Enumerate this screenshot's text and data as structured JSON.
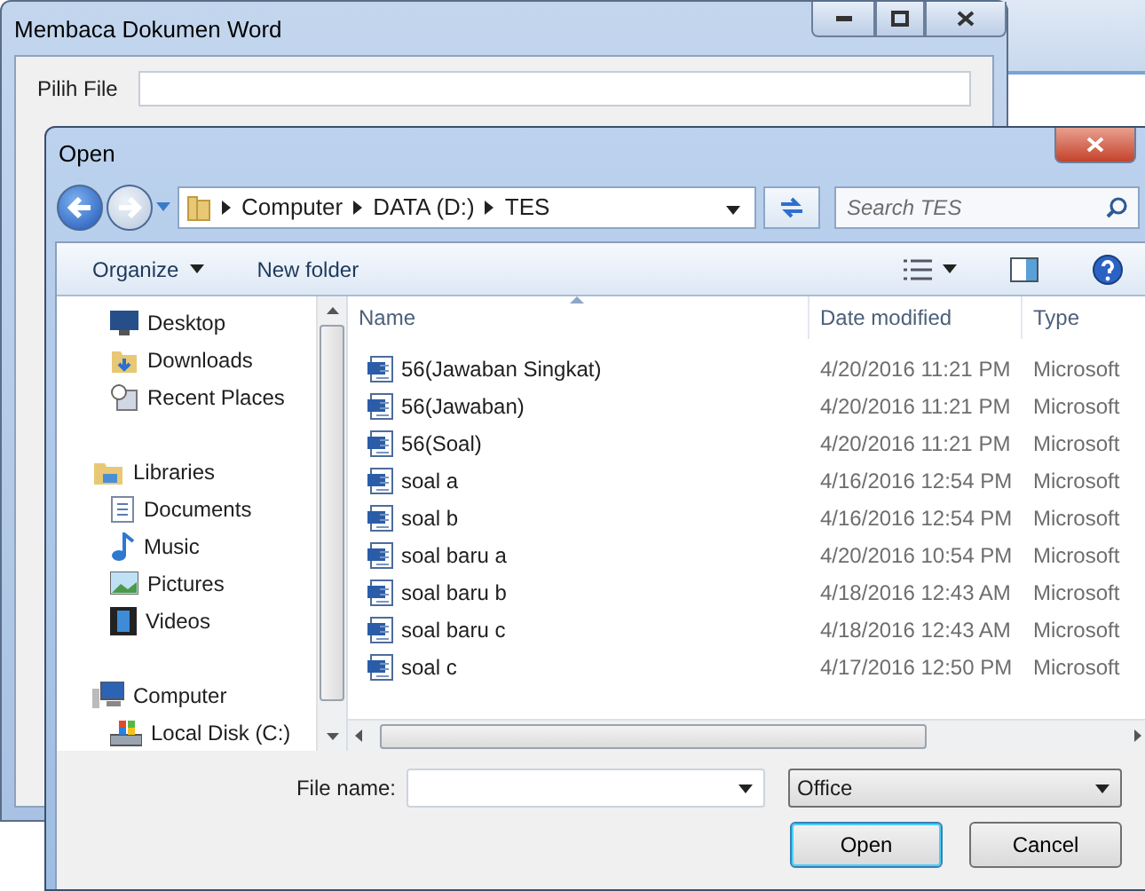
{
  "main_window": {
    "title": "Membaca Dokumen Word",
    "field_label": "Pilih File"
  },
  "dialog": {
    "title": "Open",
    "breadcrumb": [
      "Computer",
      "DATA (D:)",
      "TES"
    ],
    "search_placeholder": "Search TES",
    "toolbar": [
      "Organize",
      "New folder"
    ],
    "nav": [
      {
        "label": "Desktop",
        "kind": "item"
      },
      {
        "label": "Downloads",
        "kind": "item"
      },
      {
        "label": "Recent Places",
        "kind": "item"
      },
      {
        "label": "Libraries",
        "kind": "group"
      },
      {
        "label": "Documents",
        "kind": "item"
      },
      {
        "label": "Music",
        "kind": "item"
      },
      {
        "label": "Pictures",
        "kind": "item"
      },
      {
        "label": "Videos",
        "kind": "item"
      },
      {
        "label": "Computer",
        "kind": "group"
      },
      {
        "label": "Local Disk (C:)",
        "kind": "item"
      }
    ],
    "columns": [
      {
        "label": "Name",
        "sorted": true
      },
      {
        "label": "Date modified",
        "sorted": false
      },
      {
        "label": "Type",
        "sorted": false
      }
    ],
    "files": [
      {
        "name": "56(Jawaban Singkat)",
        "date": "4/20/2016 11:21 PM",
        "type": "Microsoft"
      },
      {
        "name": "56(Jawaban)",
        "date": "4/20/2016 11:21 PM",
        "type": "Microsoft"
      },
      {
        "name": "56(Soal)",
        "date": "4/20/2016 11:21 PM",
        "type": "Microsoft"
      },
      {
        "name": "soal a",
        "date": "4/16/2016 12:54 PM",
        "type": "Microsoft"
      },
      {
        "name": "soal b",
        "date": "4/16/2016 12:54 PM",
        "type": "Microsoft"
      },
      {
        "name": "soal baru a",
        "date": "4/20/2016 10:54 PM",
        "type": "Microsoft"
      },
      {
        "name": "soal baru b",
        "date": "4/18/2016 12:43 AM",
        "type": "Microsoft"
      },
      {
        "name": "soal baru c",
        "date": "4/18/2016 12:43 AM",
        "type": "Microsoft"
      },
      {
        "name": "soal c",
        "date": "4/17/2016 12:50 PM",
        "type": "Microsoft"
      }
    ],
    "file_name_label": "File name:",
    "file_type": "Office",
    "buttons": [
      {
        "label": "Open",
        "default": true
      },
      {
        "label": "Cancel",
        "default": false
      }
    ]
  }
}
